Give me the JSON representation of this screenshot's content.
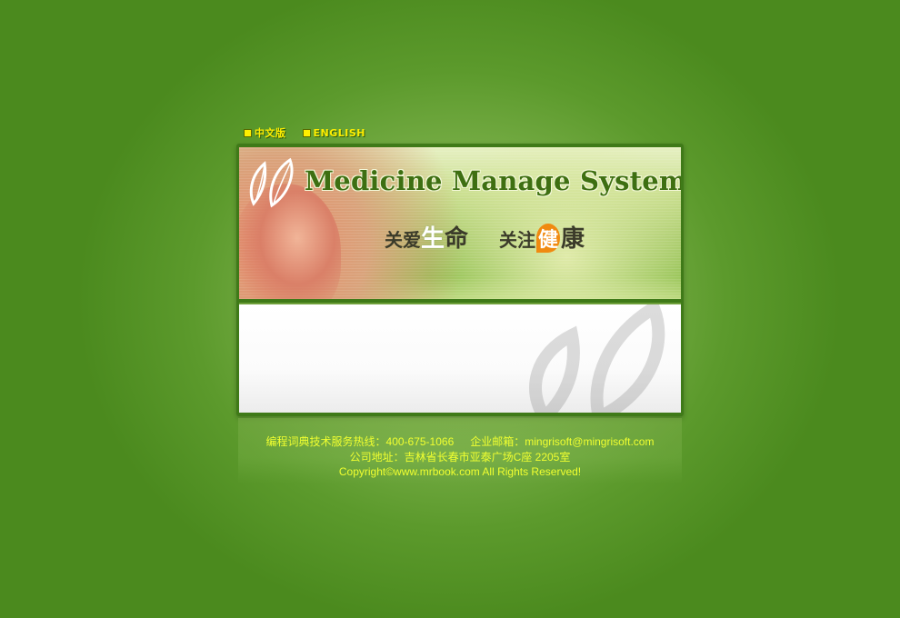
{
  "language_bar": {
    "chinese_label": "中文版",
    "english_label": "ENGLISH"
  },
  "banner": {
    "title": "Medicine Manage System",
    "slogan_left": {
      "part1": "关爱",
      "part2": "生",
      "part3": "命"
    },
    "slogan_right": {
      "part1": "关注",
      "part2": "健",
      "part3": "康"
    }
  },
  "footer": {
    "hotline": "编程词典技术服务热线：400-675-1066",
    "email": "企业邮箱：mingrisoft@mingrisoft.com",
    "address": "公司地址：吉林省长春市亚泰广场C座 2205室",
    "copyright": "Copyright©www.mrbook.com All Rights Reserved!"
  },
  "colors": {
    "background_green": "#4b8a1e",
    "footer_text_yellow": "#f0ff30",
    "lang_yellow": "#ffee00",
    "title_green": "#3e6f12",
    "accent_orange": "#f08a10"
  }
}
